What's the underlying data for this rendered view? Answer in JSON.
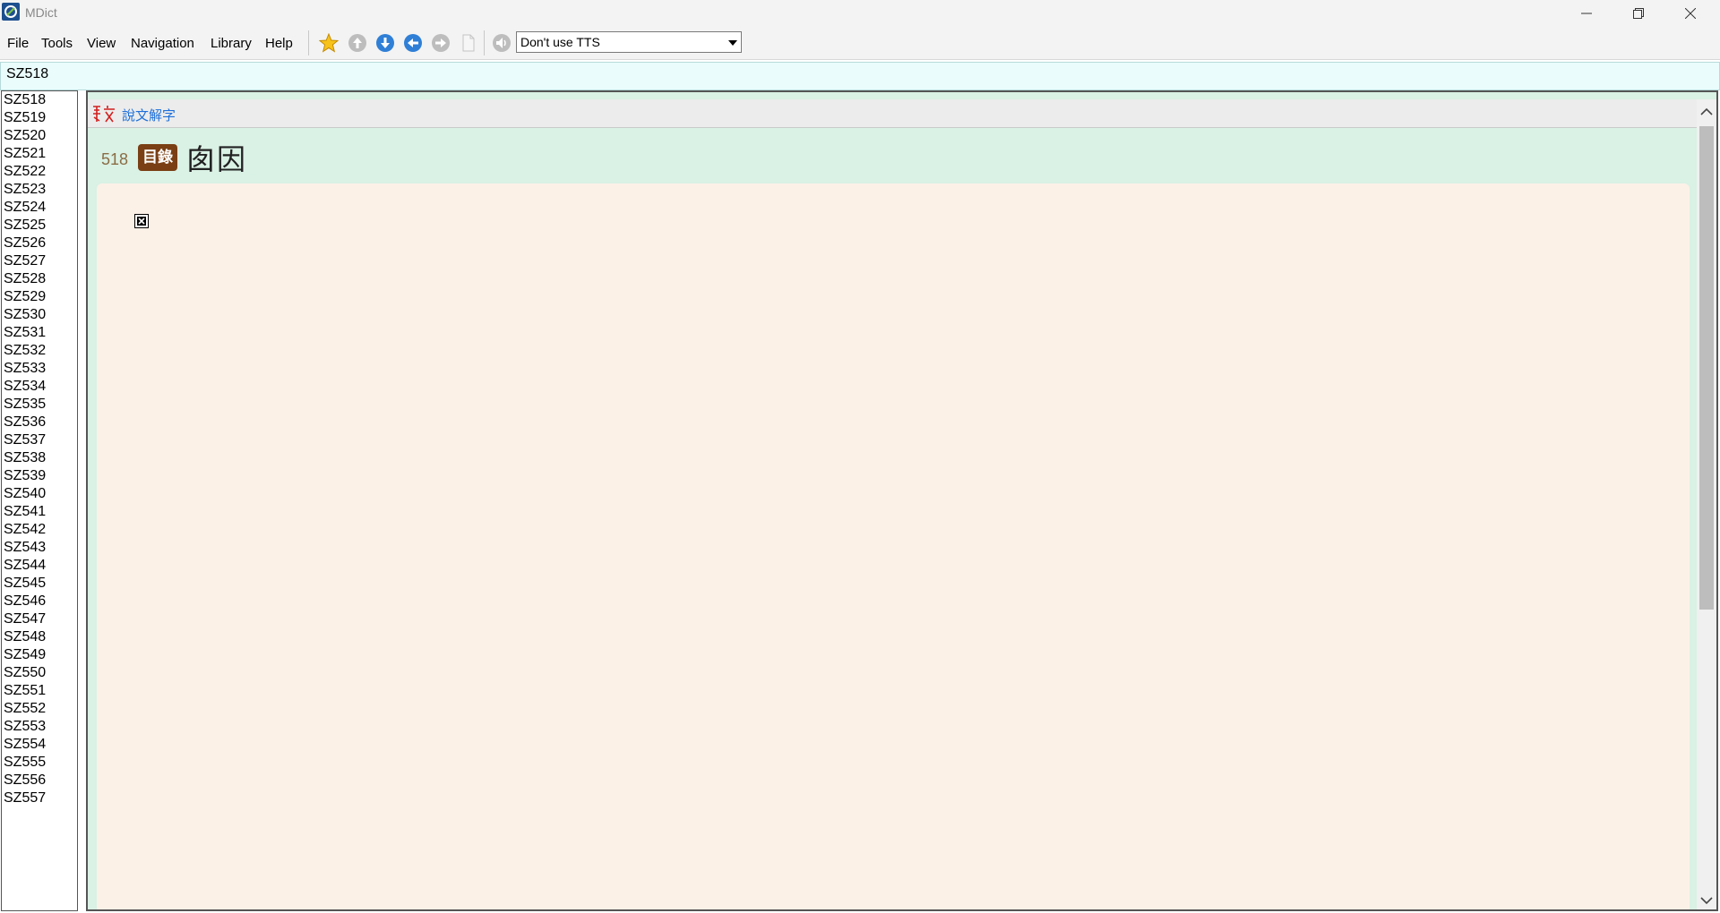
{
  "window": {
    "title": "MDict"
  },
  "menu": {
    "file": "File",
    "tools": "Tools",
    "view": "View",
    "navigation": "Navigation",
    "library": "Library",
    "help": "Help"
  },
  "toolbar": {
    "icons": [
      "star-icon",
      "arrow-up-icon",
      "arrow-down-icon",
      "arrow-left-icon",
      "arrow-right-icon",
      "page-icon",
      "speaker-icon"
    ],
    "tts_selected": "Don't use TTS"
  },
  "search": {
    "value": "SZ518"
  },
  "wordlist": {
    "items": [
      "SZ518",
      "SZ519",
      "SZ520",
      "SZ521",
      "SZ522",
      "SZ523",
      "SZ524",
      "SZ525",
      "SZ526",
      "SZ527",
      "SZ528",
      "SZ529",
      "SZ530",
      "SZ531",
      "SZ532",
      "SZ533",
      "SZ534",
      "SZ535",
      "SZ536",
      "SZ537",
      "SZ538",
      "SZ539",
      "SZ540",
      "SZ541",
      "SZ542",
      "SZ543",
      "SZ544",
      "SZ545",
      "SZ546",
      "SZ547",
      "SZ548",
      "SZ549",
      "SZ550",
      "SZ551",
      "SZ552",
      "SZ553",
      "SZ554",
      "SZ555",
      "SZ556",
      "SZ557"
    ]
  },
  "dictionary": {
    "name": "說文解字",
    "entry_number": "518",
    "badge": "目錄",
    "headword": "囱因"
  },
  "colors": {
    "dict_link": "#1e6fd9",
    "badge_bg": "#7a3f14",
    "content_bg": "#daf1e5",
    "entry_bg": "#fcf1e7",
    "search_bg": "#eafcfc"
  }
}
